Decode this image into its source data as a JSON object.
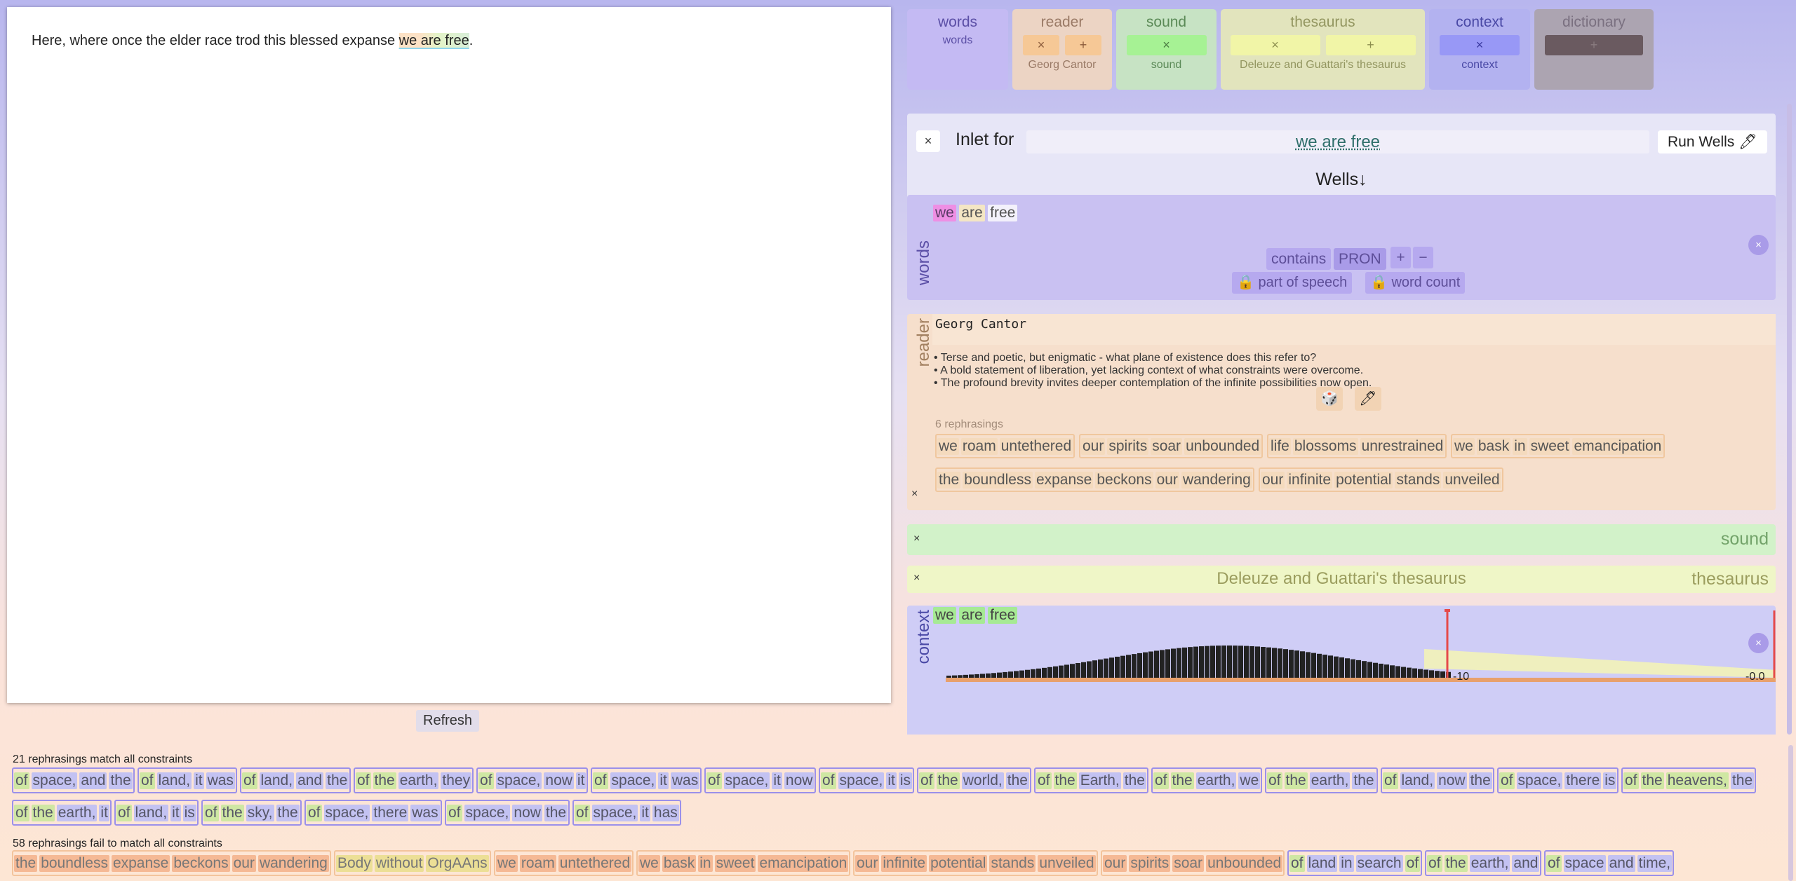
{
  "editor": {
    "text_before": "Here, where once the elder race trod this blessed expanse ",
    "highlight": "we are free",
    "text_after": ".",
    "refresh_label": "Refresh"
  },
  "modules": {
    "words": {
      "title": "words",
      "sub": "words"
    },
    "reader": {
      "title": "reader",
      "x": "×",
      "plus": "+",
      "sub": "Georg Cantor"
    },
    "sound": {
      "title": "sound",
      "x": "×",
      "sub": "sound"
    },
    "thesaurus": {
      "title": "thesaurus",
      "x": "×",
      "plus": "+",
      "sub": "Deleuze and Guattari's thesaurus"
    },
    "context": {
      "title": "context",
      "x": "×",
      "sub": "context"
    },
    "dictionary": {
      "title": "dictionary",
      "plus": "+"
    }
  },
  "inlet": {
    "close": "×",
    "label": "Inlet for",
    "value": "we are free",
    "run_label": "Run Wells 🖊",
    "wells_heading": "Wells↓"
  },
  "words_section": {
    "label": "words",
    "chips": [
      "we",
      "are",
      "free"
    ],
    "contains": "contains",
    "pron": "PRON",
    "plus": "+",
    "minus": "−",
    "pos_lock": "🔒 part of speech",
    "count_lock": "🔒 word count",
    "close": "×"
  },
  "reader_section": {
    "label": "reader",
    "name": "Georg Cantor",
    "bullets": [
      "Terse and poetic, but enigmatic - what plane of existence does this refer to?",
      "A bold statement of liberation, yet lacking context of what constraints were overcome.",
      "The profound brevity invites deeper contemplation of the infinite possibilities now open."
    ],
    "dice_icon": "🎲",
    "pen_icon": "🖊",
    "rephrasing_count": "6 rephrasings",
    "close": "×",
    "rephrasings": [
      [
        "we",
        "roam",
        "untethered"
      ],
      [
        "our",
        "spirits",
        "soar",
        "unbounded"
      ],
      [
        "life",
        "blossoms",
        "unrestrained"
      ],
      [
        "we",
        "bask",
        "in",
        "sweet",
        "emancipation"
      ],
      [
        "the",
        "boundless",
        "expanse",
        "beckons",
        "our",
        "wandering"
      ],
      [
        "our",
        "infinite",
        "potential",
        "stands",
        "unveiled"
      ]
    ]
  },
  "sound_section": {
    "close": "×",
    "title": "sound"
  },
  "thesaurus_section": {
    "close": "×",
    "center": "Deleuze and Guattari's thesaurus",
    "title": "thesaurus"
  },
  "context_section": {
    "label": "context",
    "chips": [
      "we",
      "are",
      "free"
    ],
    "close": "×",
    "threshold_label": "-10",
    "max_label": "-0.0"
  },
  "results": {
    "match_count": "21 rephrasings match all constraints",
    "matches": [
      [
        "of",
        "space,",
        "and",
        "the"
      ],
      [
        "of",
        "land,",
        "it",
        "was"
      ],
      [
        "of",
        "land,",
        "and",
        "the"
      ],
      [
        "of",
        "the",
        "earth,",
        "they"
      ],
      [
        "of",
        "space,",
        "now",
        "it"
      ],
      [
        "of",
        "space,",
        "it",
        "was"
      ],
      [
        "of",
        "space,",
        "it",
        "now"
      ],
      [
        "of",
        "space,",
        "it",
        "is"
      ],
      [
        "of",
        "the",
        "world,",
        "the"
      ],
      [
        "of",
        "the",
        "Earth,",
        "the"
      ],
      [
        "of",
        "the",
        "earth,",
        "we"
      ],
      [
        "of",
        "the",
        "earth,",
        "the"
      ],
      [
        "of",
        "land,",
        "now",
        "the"
      ],
      [
        "of",
        "space,",
        "there",
        "is"
      ],
      [
        "of",
        "the",
        "heavens,",
        "the"
      ],
      [
        "of",
        "the",
        "earth,",
        "it"
      ],
      [
        "of",
        "land,",
        "it",
        "is"
      ],
      [
        "of",
        "the",
        "sky,",
        "the"
      ],
      [
        "of",
        "space,",
        "there",
        "was"
      ],
      [
        "of",
        "space,",
        "now",
        "the"
      ],
      [
        "of",
        "space,",
        "it",
        "has"
      ]
    ],
    "fail_count": "58 rephrasings fail to match all constraints",
    "fails": [
      [
        "the",
        "boundless",
        "expanse",
        "beckons",
        "our",
        "wandering"
      ],
      [
        "Body",
        "without",
        "OrgAAns"
      ],
      [
        "we",
        "roam",
        "untethered"
      ],
      [
        "we",
        "bask",
        "in",
        "sweet",
        "emancipation"
      ],
      [
        "our",
        "infinite",
        "potential",
        "stands",
        "unveiled"
      ],
      [
        "our",
        "spirits",
        "soar",
        "unbounded"
      ],
      [
        "of",
        "land",
        "in",
        "search",
        "of"
      ],
      [
        "of",
        "the",
        "earth,",
        "and"
      ],
      [
        "of",
        "space",
        "and",
        "time,"
      ]
    ]
  },
  "colors": {
    "words": "#c4baf3",
    "reader": "#ecd4c4",
    "sound": "#c7e3c4",
    "thesaurus": "#e2e4bd",
    "context": "#b3b2f0",
    "dictionary": "#aca4b1"
  }
}
